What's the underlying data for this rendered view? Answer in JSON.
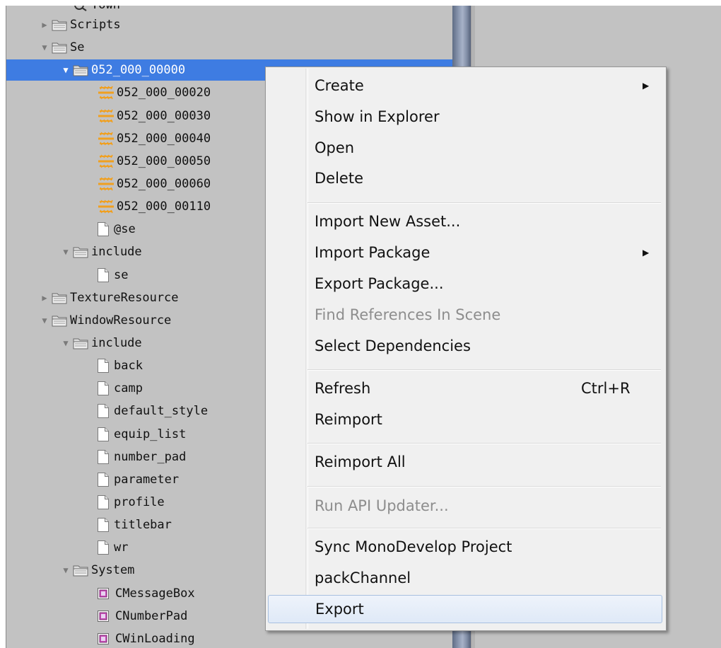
{
  "tree": {
    "clipped_item": {
      "label": "Town"
    },
    "items": [
      {
        "label": "Scripts",
        "icon": "folder-icon",
        "arrow": "collapsed"
      },
      {
        "label": "Se",
        "icon": "folder-icon",
        "arrow": "expanded"
      },
      {
        "label": "052_000_00000",
        "icon": "folder-icon",
        "arrow": "expanded",
        "selected": true
      },
      {
        "label": "052_000_00020",
        "icon": "audio-clip-icon"
      },
      {
        "label": "052_000_00030",
        "icon": "audio-clip-icon"
      },
      {
        "label": "052_000_00040",
        "icon": "audio-clip-icon"
      },
      {
        "label": "052_000_00050",
        "icon": "audio-clip-icon"
      },
      {
        "label": "052_000_00060",
        "icon": "audio-clip-icon"
      },
      {
        "label": "052_000_00110",
        "icon": "audio-clip-icon"
      },
      {
        "label": "@se",
        "icon": "file-icon"
      },
      {
        "label": "include",
        "icon": "folder-icon",
        "arrow": "expanded"
      },
      {
        "label": "se",
        "icon": "file-icon"
      },
      {
        "label": "TextureResource",
        "icon": "folder-icon",
        "arrow": "collapsed"
      },
      {
        "label": "WindowResource",
        "icon": "folder-icon",
        "arrow": "expanded"
      },
      {
        "label": "include",
        "icon": "folder-icon",
        "arrow": "expanded"
      },
      {
        "label": "back",
        "icon": "file-icon"
      },
      {
        "label": "camp",
        "icon": "file-icon"
      },
      {
        "label": "default_style",
        "icon": "file-icon"
      },
      {
        "label": "equip_list",
        "icon": "file-icon"
      },
      {
        "label": "number_pad",
        "icon": "file-icon"
      },
      {
        "label": "parameter",
        "icon": "file-icon"
      },
      {
        "label": "profile",
        "icon": "file-icon"
      },
      {
        "label": "titlebar",
        "icon": "file-icon"
      },
      {
        "label": "wr",
        "icon": "file-icon"
      },
      {
        "label": "System",
        "icon": "folder-icon",
        "arrow": "expanded"
      },
      {
        "label": "CMessageBox",
        "icon": "script-icon"
      },
      {
        "label": "CNumberPad",
        "icon": "script-icon"
      },
      {
        "label": "CWinLoading",
        "icon": "script-icon"
      }
    ]
  },
  "context_menu": {
    "items": [
      {
        "label": "Create",
        "submenu": true
      },
      {
        "label": "Show in Explorer"
      },
      {
        "label": "Open"
      },
      {
        "label": "Delete"
      },
      {
        "label": "Import New Asset..."
      },
      {
        "label": "Import Package",
        "submenu": true
      },
      {
        "label": "Export Package..."
      },
      {
        "label": "Find References In Scene",
        "disabled": true
      },
      {
        "label": "Select Dependencies"
      },
      {
        "label": "Refresh",
        "shortcut": "Ctrl+R"
      },
      {
        "label": "Reimport"
      },
      {
        "label": "Reimport All"
      },
      {
        "label": "Run API Updater...",
        "disabled": true
      },
      {
        "label": "Sync MonoDevelop Project"
      },
      {
        "label": "packChannel"
      },
      {
        "label": "Export",
        "hover": true
      }
    ]
  },
  "colors": {
    "panel_bg": "#c2c2c2",
    "selection": "#3e7ce2",
    "menu_bg": "#f0f0f0",
    "disabled_text": "#8d8d8d",
    "audio_icon": "#f0a020"
  }
}
